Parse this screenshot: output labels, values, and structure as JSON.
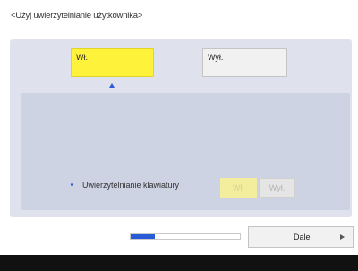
{
  "dialog": {
    "title": "<Użyj uwierzytelnianie użytkownika>"
  },
  "choice": {
    "on_label": "Wł.",
    "off_label": "Wył.",
    "selected": "on"
  },
  "keyboard_auth": {
    "label": "Uwierzytelnianie klawiatury",
    "on_label": "Wł.",
    "off_label": "Wył."
  },
  "footer": {
    "next_label": "Dalej",
    "progress": 0.22
  },
  "colors": {
    "accent": "#2a5bd7",
    "selected": "#fff23a",
    "panel": "#dfe2ec"
  }
}
